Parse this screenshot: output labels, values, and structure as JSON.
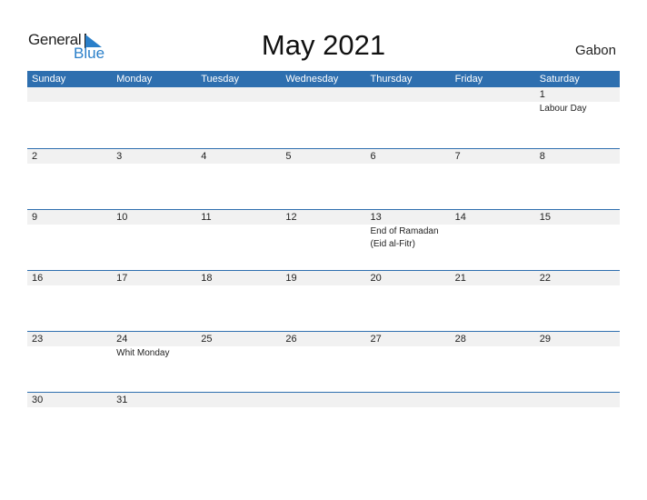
{
  "logo": {
    "general": "General",
    "blue": "Blue"
  },
  "title": "May 2021",
  "country": "Gabon",
  "colors": {
    "header_bg": "#2e6faf",
    "accent": "#2a7fc9",
    "strip_bg": "#f1f1f1"
  },
  "weekdays": [
    "Sunday",
    "Monday",
    "Tuesday",
    "Wednesday",
    "Thursday",
    "Friday",
    "Saturday"
  ],
  "weeks": [
    [
      {
        "d": ""
      },
      {
        "d": ""
      },
      {
        "d": ""
      },
      {
        "d": ""
      },
      {
        "d": ""
      },
      {
        "d": ""
      },
      {
        "d": "1",
        "ev": [
          "Labour Day"
        ]
      }
    ],
    [
      {
        "d": "2"
      },
      {
        "d": "3"
      },
      {
        "d": "4"
      },
      {
        "d": "5"
      },
      {
        "d": "6"
      },
      {
        "d": "7"
      },
      {
        "d": "8"
      }
    ],
    [
      {
        "d": "9"
      },
      {
        "d": "10"
      },
      {
        "d": "11"
      },
      {
        "d": "12"
      },
      {
        "d": "13",
        "ev": [
          "End of Ramadan",
          "(Eid al-Fitr)"
        ]
      },
      {
        "d": "14"
      },
      {
        "d": "15"
      }
    ],
    [
      {
        "d": "16"
      },
      {
        "d": "17"
      },
      {
        "d": "18"
      },
      {
        "d": "19"
      },
      {
        "d": "20"
      },
      {
        "d": "21"
      },
      {
        "d": "22"
      }
    ],
    [
      {
        "d": "23"
      },
      {
        "d": "24",
        "ev": [
          "Whit Monday"
        ]
      },
      {
        "d": "25"
      },
      {
        "d": "26"
      },
      {
        "d": "27"
      },
      {
        "d": "28"
      },
      {
        "d": "29"
      }
    ],
    [
      {
        "d": "30"
      },
      {
        "d": "31"
      },
      {
        "d": ""
      },
      {
        "d": ""
      },
      {
        "d": ""
      },
      {
        "d": ""
      },
      {
        "d": ""
      }
    ]
  ]
}
